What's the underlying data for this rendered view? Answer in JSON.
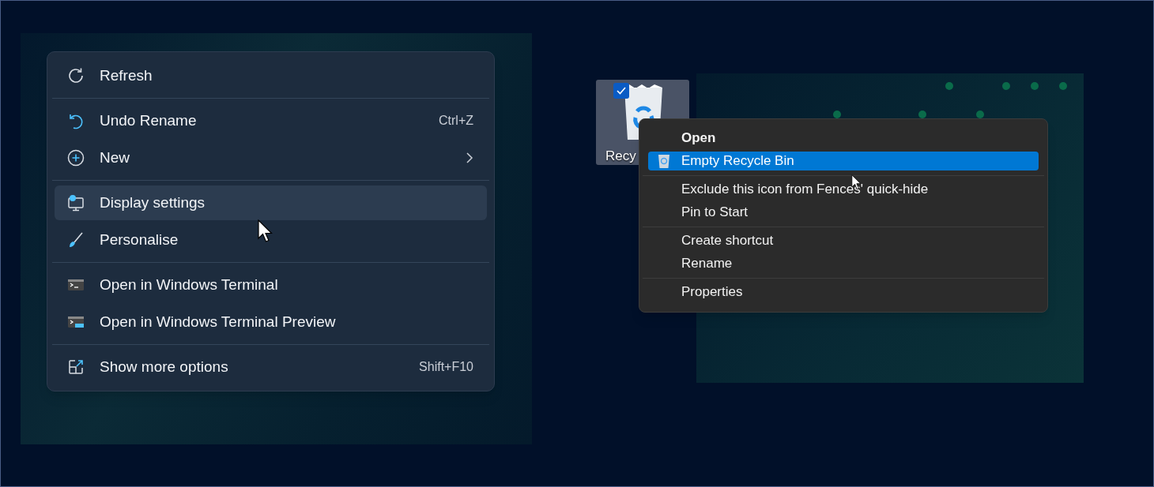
{
  "desktop_menu": {
    "sections": [
      [
        {
          "label": "Refresh",
          "selected": false
        }
      ],
      [
        {
          "label": "Undo Rename",
          "shortcut": "Ctrl+Z",
          "selected": false
        },
        {
          "label": "New",
          "submenu": true,
          "selected": false
        }
      ],
      [
        {
          "label": "Display settings",
          "selected": true
        },
        {
          "label": "Personalise",
          "selected": false
        }
      ],
      [
        {
          "label": "Open in Windows Terminal",
          "selected": false
        },
        {
          "label": "Open in Windows Terminal Preview",
          "selected": false
        }
      ],
      [
        {
          "label": "Show more options",
          "shortcut": "Shift+F10",
          "selected": false
        }
      ]
    ]
  },
  "desktop_icon": {
    "label": "Recy",
    "selected": true,
    "checked": true
  },
  "recycle_menu": {
    "sections": [
      [
        {
          "label": "Open",
          "default": true,
          "selected": false
        },
        {
          "label": "Empty Recycle Bin",
          "default": false,
          "selected": true
        }
      ],
      [
        {
          "label": "Exclude this icon from Fences' quick-hide",
          "default": false,
          "selected": false
        },
        {
          "label": "Pin to Start",
          "default": false,
          "selected": false
        }
      ],
      [
        {
          "label": "Create shortcut",
          "default": false,
          "selected": false
        },
        {
          "label": "Rename",
          "default": false,
          "selected": false
        }
      ],
      [
        {
          "label": "Properties",
          "default": false,
          "selected": false
        }
      ]
    ]
  }
}
